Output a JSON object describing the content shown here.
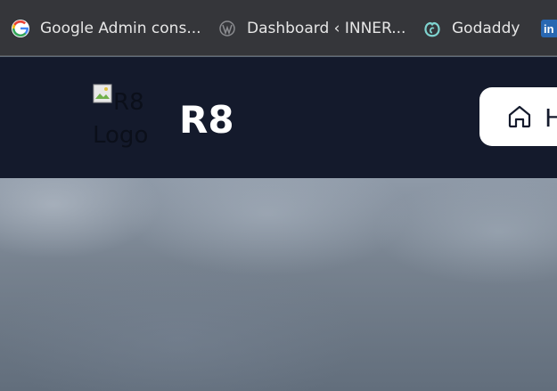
{
  "bookmarks": [
    {
      "label": "Google Admin cons...",
      "icon": "google-icon"
    },
    {
      "label": "Dashboard ‹ INNER...",
      "icon": "wordpress-icon"
    },
    {
      "label": "Godaddy",
      "icon": "godaddy-icon"
    },
    {
      "label": "",
      "icon": "linkedin-icon"
    }
  ],
  "header": {
    "logo_alt_line1": "R8",
    "logo_alt_line2": "Logo",
    "brand": "R8",
    "nav_home_label": "H"
  },
  "colors": {
    "bookmarks_bg": "#35363a",
    "header_bg": "#141a2c",
    "nav_pill_bg": "#ffffff",
    "text_light": "#e6e6e6"
  }
}
